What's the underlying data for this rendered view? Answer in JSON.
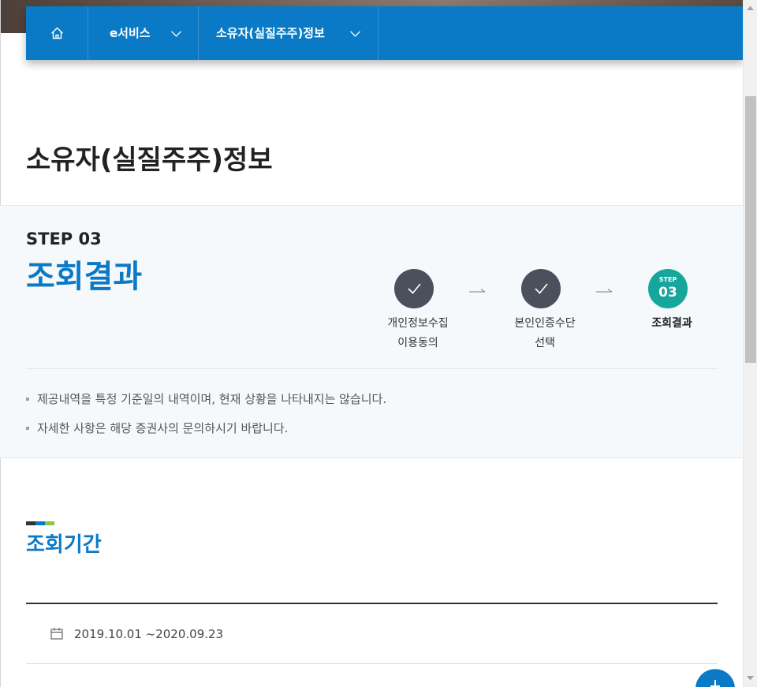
{
  "nav": {
    "home_icon": "home-icon",
    "items": [
      {
        "label": "e서비스",
        "icon": "chevron-down-icon"
      },
      {
        "label": "소유자(실질주주)정보",
        "icon": "chevron-down-icon"
      }
    ]
  },
  "page": {
    "title": "소유자(실질주주)정보"
  },
  "step": {
    "current_label": "STEP 03",
    "current_title": "조회결과",
    "separator_icon": "arrow-right-icon",
    "steps": [
      {
        "icon": "check-icon",
        "lines": [
          "개인정보수집",
          "이용동의"
        ]
      },
      {
        "icon": "check-icon",
        "lines": [
          "본인인증수단",
          "선택"
        ]
      },
      {
        "badge_small": "STEP",
        "badge_number": "03",
        "lines": [
          "조회결과"
        ]
      }
    ]
  },
  "notices": [
    "제공내역을 특정 기준일의 내역이며, 현재 상황을 나타내지는 않습니다.",
    "자세한 사항은 해당 증권사의 문의하시기 바랍니다."
  ],
  "period": {
    "title": "조회기간",
    "icon": "calendar-icon",
    "range": "2019.10.01 ~2020.09.23"
  },
  "fab": {
    "icon": "plus-icon"
  },
  "colors": {
    "primary": "#0a7ac6",
    "step_done": "#4b505d",
    "step_current": "#16a69b",
    "section_bg": "#f5f9fc",
    "accent_green": "#8dc63f",
    "accent_dark": "#333333"
  }
}
